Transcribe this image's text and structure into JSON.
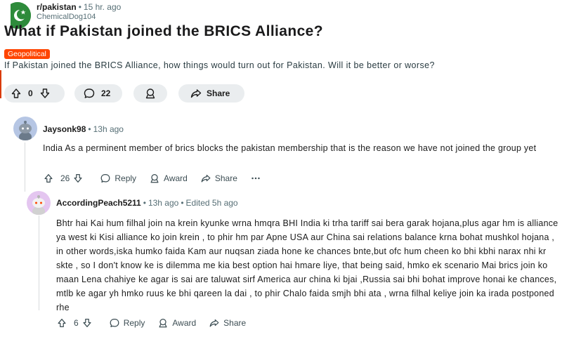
{
  "post": {
    "subreddit": "r/pakistan",
    "time": "15 hr. ago",
    "author": "ChemicalDog104",
    "title": "What if Pakistan joined the BRICS Alliance?",
    "flair": "Geopolitical",
    "body": "If Pakistan joined the BRICS Alliance, how things would turn out for Pakistan. Will it be better or worse?",
    "votes": "0",
    "comments_count": "22",
    "share_label": "Share",
    "colors": {
      "flair": "#ff4500",
      "subreddit_icon": "#2e8b3b"
    }
  },
  "comments": [
    {
      "username": "Jaysonk98",
      "time": "13h ago",
      "edited": "",
      "text": "India As a perminent member of brics blocks the pakistan membership that is the reason we have not joined the group yet",
      "votes": "26",
      "reply_label": "Reply",
      "award_label": "Award",
      "share_label": "Share"
    },
    {
      "username": "AccordingPeach5211",
      "time": "13h ago",
      "edited": "Edited 5h ago",
      "text": "Bhtr hai Kai hum filhal join na krein kyunke wrna hmqra BHI India ki trha tariff sai bera garak hojana,plus agar hm is alliance ya west ki Kisi alliance ko join krein , to phir hm par Apne USA aur China sai relations balance krna bohat mushkol hojana , in other words,iska humko faida Kam aur nuqsan ziada hone ke chances bnte,but ofc hum cheen ko bhi kbhi narax nhi kr skte , so I don't know ke is dilemma me kia best option hai hmare liye, that being said, hmko ek scenario Mai brics join ko maan Lena chahiye ke agar is sai are taluwat sirf America aur china ki bjai ,Russia sai bhi bohat improve honai ke chances, mtlb ke agar yh hmko ruus ke bhi qareen la dai , to phir Chalo faida smjh bhi ata , wrna filhal keliye join ka irada postponed rhe",
      "votes": "6",
      "reply_label": "Reply",
      "award_label": "Award",
      "share_label": "Share"
    }
  ]
}
